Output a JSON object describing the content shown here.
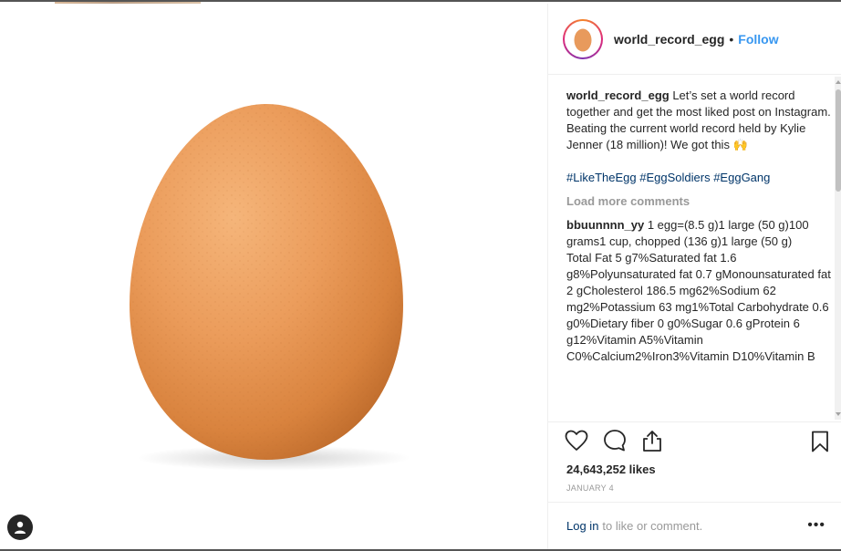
{
  "post": {
    "username": "world_record_egg",
    "separator": "•",
    "follow_label": "Follow"
  },
  "caption": {
    "username": "world_record_egg",
    "text": "Let’s set a world record together and get the most liked post on Instagram. Beating the current world record held by Kylie Jenner (18 million)! We got this 🙌",
    "hashtags": [
      "#LikeTheEgg",
      "#EggSoldiers",
      "#EggGang"
    ]
  },
  "load_more_label": "Load more comments",
  "comment": {
    "username": "bbuunnnn_yy",
    "text_1": "1 egg=(8.5 g)1 large (50 g)100 grams1 cup, chopped (136 g)1 large (50 g)",
    "text_2": "Total Fat 5 g7%Saturated fat 1.6 g8%Polyunsaturated fat 0.7 gMonounsaturated fat 2 gCholesterol 186.5 mg62%Sodium 62 mg2%Potassium 63 mg1%Total Carbohydrate 0.6 g0%Dietary fiber 0 g0%Sugar 0.6 gProtein 6 g12%Vitamin A5%Vitamin C0%Calcium2%Iron3%Vitamin D10%Vitamin B"
  },
  "likes_label": "24,643,252 likes",
  "date_label": "JANUARY 4",
  "login": {
    "link_label": "Log in",
    "rest_label": "to like or comment.",
    "more_label": "•••"
  },
  "icons": {
    "like": "heart-icon",
    "comment": "comment-icon",
    "share": "share-icon",
    "save": "bookmark-icon",
    "profile": "user-icon"
  },
  "colors": {
    "link_blue": "#3897f0",
    "hashtag": "#003569",
    "muted": "#999999",
    "egg": "#e89a5c"
  }
}
